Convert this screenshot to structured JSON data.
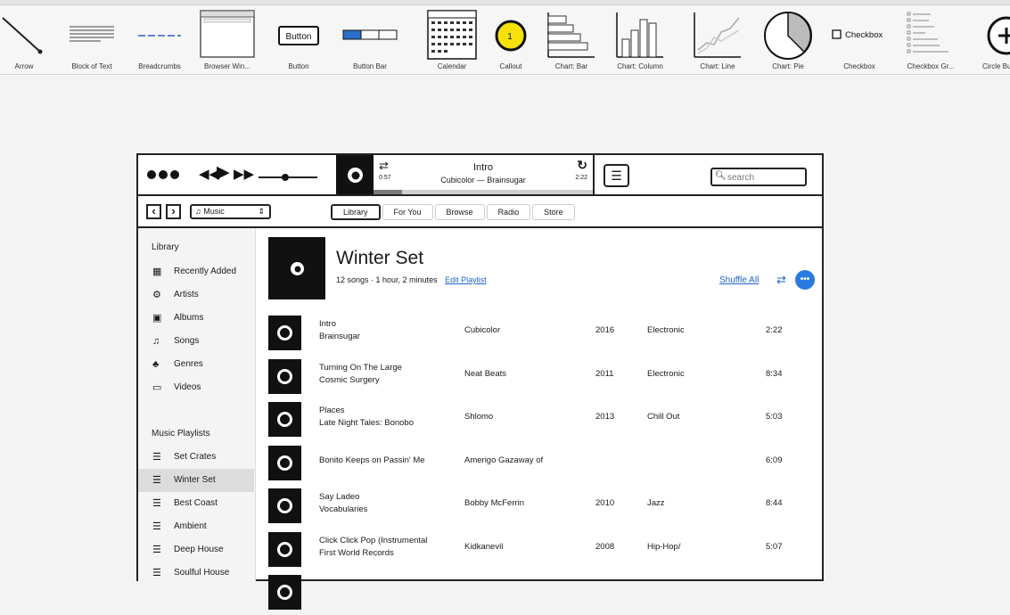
{
  "library_strip": {
    "items": [
      {
        "label": "Arrow"
      },
      {
        "label": "Block of Text"
      },
      {
        "label": "Breadcrumbs"
      },
      {
        "label": "Browser Win..."
      },
      {
        "label": "Button",
        "thumb_text": "Button"
      },
      {
        "label": "Button Bar"
      },
      {
        "label": "Calendar"
      },
      {
        "label": "Callout",
        "thumb_text": "1"
      },
      {
        "label": "Chart: Bar"
      },
      {
        "label": "Chart: Column"
      },
      {
        "label": "Chart: Line"
      },
      {
        "label": "Chart: Pie"
      },
      {
        "label": "Checkbox",
        "thumb_text": "Checkbox"
      },
      {
        "label": "Checkbox Gr..."
      },
      {
        "label": "Circle Bu..."
      }
    ]
  },
  "player": {
    "prev_icon": "rewind-icon",
    "play_icon": "play-icon",
    "next_icon": "fast-forward-icon",
    "volume_level": 0.45,
    "elapsed": "0:57",
    "remaining": "2:22",
    "track_title": "Intro",
    "track_artist": "Cubicolor — Brainsugar",
    "progress": 0.13,
    "search_placeholder": "search"
  },
  "nav": {
    "source": "Music",
    "tabs": [
      {
        "label": "Library",
        "active": true
      },
      {
        "label": "For You"
      },
      {
        "label": "Browse"
      },
      {
        "label": "Radio"
      },
      {
        "label": "Store"
      }
    ]
  },
  "sidebar": {
    "library_heading": "Library",
    "library_items": [
      {
        "label": "Recently Added",
        "icon": "calendar-icon"
      },
      {
        "label": "Artists",
        "icon": "microphone-icon"
      },
      {
        "label": "Albums",
        "icon": "album-icon"
      },
      {
        "label": "Songs",
        "icon": "music-note-icon"
      },
      {
        "label": "Genres",
        "icon": "genres-icon"
      },
      {
        "label": "Videos",
        "icon": "monitor-icon"
      }
    ],
    "playlists_heading": "Music Playlists",
    "playlists": [
      {
        "label": "Set Crates"
      },
      {
        "label": "Winter Set",
        "active": true
      },
      {
        "label": "Best Coast"
      },
      {
        "label": "Ambient"
      },
      {
        "label": "Deep House"
      },
      {
        "label": "Soulful House"
      }
    ]
  },
  "playlist": {
    "title": "Winter Set",
    "meta": "12 songs · 1 hour, 2 minutes",
    "edit_label": "Edit Playlist",
    "shuffle_label": "Shuffle All",
    "more_label": "•••",
    "songs": [
      {
        "title": "Intro",
        "album": "Brainsugar",
        "artist": "Cubicolor",
        "year": "2016",
        "genre": "Electronic",
        "time": "2:22"
      },
      {
        "title": "Turning On The Large",
        "album": "Cosmic Surgery",
        "artist": "Neat Beats",
        "year": "2011",
        "genre": "Electronic",
        "time": "8:34"
      },
      {
        "title": "Places",
        "album": "Late Night Tales: Bonobo",
        "artist": "Shlomo",
        "year": "2013",
        "genre": "Chill Out",
        "time": "5:03"
      },
      {
        "title": "Bonito Keeps on Passin' Me",
        "album": "",
        "artist": "Amerigo Gazaway of",
        "year": "",
        "genre": "",
        "time": "6:09"
      },
      {
        "title": "Say Ladeo",
        "album": "Vocabularies",
        "artist": "Bobby McFerrin",
        "year": "2010",
        "genre": "Jazz",
        "time": "8:44"
      },
      {
        "title": "Click Click Pop (Instrumental",
        "album": "First World Records",
        "artist": "Kidkanevil",
        "year": "2008",
        "genre": "Hip-Hop/",
        "time": "5:07"
      },
      {
        "title": "",
        "album": "",
        "artist": "",
        "year": "",
        "genre": "",
        "time": ""
      }
    ]
  }
}
